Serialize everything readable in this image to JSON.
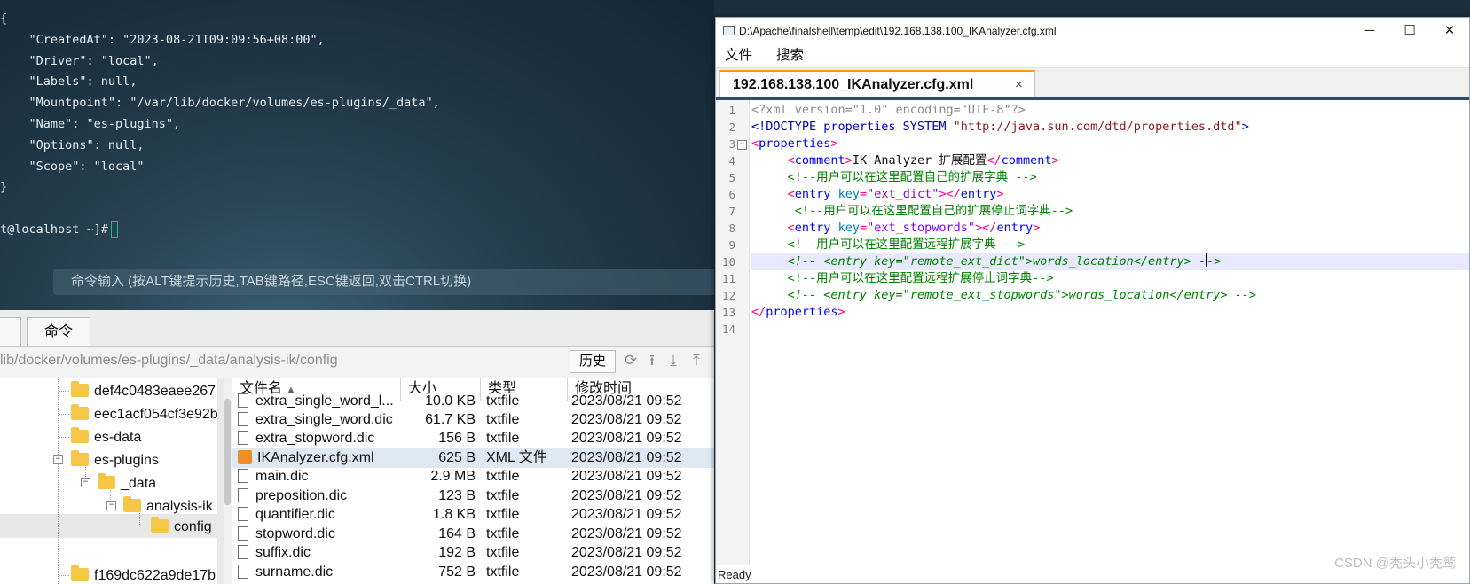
{
  "terminal": {
    "lines": [
      "{",
      "    \"CreatedAt\": \"2023-08-21T09:09:56+08:00\",",
      "    \"Driver\": \"local\",",
      "    \"Labels\": null,",
      "    \"Mountpoint\": \"/var/lib/docker/volumes/es-plugins/_data\",",
      "    \"Name\": \"es-plugins\",",
      "    \"Options\": null,",
      "    \"Scope\": \"local\"",
      "}",
      "",
      "t@localhost ~]#"
    ],
    "command_hint": "命令输入 (按ALT键提示历史,TAB键路径,ESC键返回,双击CTRL切换)"
  },
  "file_manager": {
    "tabs": [
      "",
      "命令"
    ],
    "path": "lib/docker/volumes/es-plugins/_data/analysis-ik/config",
    "history_label": "历史",
    "toolbar_icons": [
      "refresh-icon",
      "upload-icon",
      "download-icon",
      "upload-tray-icon"
    ],
    "tree": [
      {
        "label": "def4c0483eaee267",
        "level": 0
      },
      {
        "label": "eec1acf054cf3e92b",
        "level": 0
      },
      {
        "label": "es-data",
        "level": 0
      },
      {
        "label": "es-plugins",
        "level": 0,
        "expanded": true
      },
      {
        "label": "_data",
        "level": 1,
        "expanded": true
      },
      {
        "label": "analysis-ik",
        "level": 2,
        "expanded": true
      },
      {
        "label": "config",
        "level": 3,
        "selected": true
      },
      {
        "label": "f169dc622a9de17b",
        "level": 0
      }
    ],
    "columns": [
      "文件名",
      "大小",
      "类型",
      "修改时间"
    ],
    "sort_indicator": "▲",
    "files": [
      {
        "name": "extra_single_word_l...",
        "size": "10.0 KB",
        "type": "txtfile",
        "modified": "2023/08/21 09:52"
      },
      {
        "name": "extra_single_word.dic",
        "size": "61.7 KB",
        "type": "txtfile",
        "modified": "2023/08/21 09:52"
      },
      {
        "name": "extra_stopword.dic",
        "size": "156 B",
        "type": "txtfile",
        "modified": "2023/08/21 09:52"
      },
      {
        "name": "IKAnalyzer.cfg.xml",
        "size": "625 B",
        "type": "XML 文件",
        "modified": "2023/08/21 09:52",
        "selected": true
      },
      {
        "name": "main.dic",
        "size": "2.9 MB",
        "type": "txtfile",
        "modified": "2023/08/21 09:52"
      },
      {
        "name": "preposition.dic",
        "size": "123 B",
        "type": "txtfile",
        "modified": "2023/08/21 09:52"
      },
      {
        "name": "quantifier.dic",
        "size": "1.8 KB",
        "type": "txtfile",
        "modified": "2023/08/21 09:52"
      },
      {
        "name": "stopword.dic",
        "size": "164 B",
        "type": "txtfile",
        "modified": "2023/08/21 09:52"
      },
      {
        "name": "suffix.dic",
        "size": "192 B",
        "type": "txtfile",
        "modified": "2023/08/21 09:52"
      },
      {
        "name": "surname.dic",
        "size": "752 B",
        "type": "txtfile",
        "modified": "2023/08/21 09:52"
      }
    ]
  },
  "editor": {
    "title": "D:\\Apache\\finalshell\\temp\\edit\\192.168.138.100_IKAnalyzer.cfg.xml",
    "window_buttons": {
      "minimize": "─",
      "maximize": "☐",
      "close": "✕"
    },
    "menu": [
      "文件",
      "搜索"
    ],
    "tab": {
      "label": "192.168.138.100_IKAnalyzer.cfg.xml",
      "close": "×"
    },
    "line_numbers": [
      "1",
      "2",
      "3",
      "4",
      "5",
      "6",
      "7",
      "8",
      "9",
      "10",
      "11",
      "12",
      "13",
      "14"
    ],
    "code": {
      "l1": "<?xml version=\"1.0\" encoding=\"UTF-8\"?>",
      "l2a": "<!DOCTYPE properties SYSTEM ",
      "l2b": "\"http://java.sun.com/dtd/properties.dtd\"",
      "l2c": ">",
      "l4_text": "IK Analyzer 扩展配置",
      "l5": "<!--用户可以在这里配置自己的扩展字典 -->",
      "l6_key": "ext_dict",
      "l7": "<!--用户可以在这里配置自己的扩展停止词字典-->",
      "l8_key": "ext_stopwords",
      "l9": "<!--用户可以在这里配置远程扩展字典 -->",
      "l10a": "<!-- ",
      "l10b": "<entry key=\"remote_ext_dict\">",
      "l10c": "words_location",
      "l10d": "</entry>",
      "l10e": " -",
      "l10f": "->",
      "l11": "<!--用户可以在这里配置远程扩展停止词字典-->",
      "l12a": "<!-- ",
      "l12b": "<entry key=\"remote_ext_stopwords\">",
      "l12c": "words_location",
      "l12d": "</entry>",
      "l12e": " -->",
      "tag_properties": "properties",
      "tag_comment": "comment",
      "tag_entry": "entry",
      "attr_key": "key"
    },
    "status": "Ready"
  },
  "watermark": "CSDN @秃头小秃鹫",
  "colors": {
    "terminal_bg": "#1d3444",
    "cursor": "#19c37d",
    "xml_tag": "#0000ff",
    "xml_comment": "#008000",
    "tab_accent": "#f0a000"
  }
}
